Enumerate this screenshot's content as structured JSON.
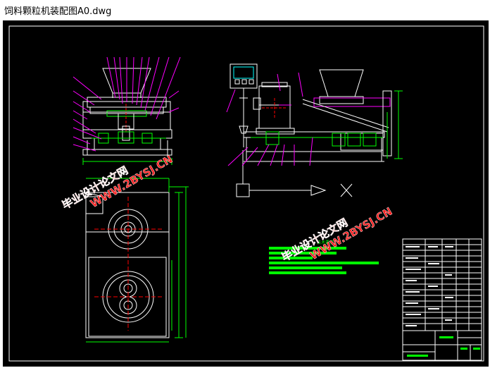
{
  "window": {
    "title": "饲料颗粒机装配图A0.dwg"
  },
  "drawing": {
    "background_color": "#000000",
    "line_color": "#ffffff",
    "dim_color": "#00ff00",
    "leader_color": "#ff00ff",
    "center_color": "#ff0000",
    "hatch_color": "#00ffff"
  },
  "watermarks": [
    {
      "line1": "毕业设计论文网",
      "line2": "WWW.2BYSJ.CN",
      "color": "#ff2020"
    },
    {
      "line1": "毕业设计论文网",
      "line2": "WWW.2BYSJ.CN",
      "color": "#ff2020"
    }
  ],
  "tech_requirements": {
    "heading": "技术要求"
  },
  "title_block": {
    "present": true
  }
}
